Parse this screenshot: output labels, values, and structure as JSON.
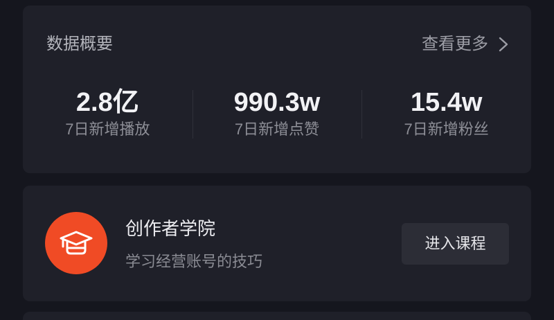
{
  "overview": {
    "title": "数据概要",
    "more_label": "查看更多",
    "more_icon": "chevron-right-icon",
    "stats": [
      {
        "value": "2.8亿",
        "label": "7日新增播放"
      },
      {
        "value": "990.3w",
        "label": "7日新增点赞"
      },
      {
        "value": "15.4w",
        "label": "7日新增粉丝"
      }
    ]
  },
  "academy": {
    "icon": "graduation-cap-icon",
    "title": "创作者学院",
    "subtitle": "学习经营账号的技巧",
    "button_label": "进入课程"
  },
  "colors": {
    "page_background": "#15161e",
    "card_background": "#1f2029",
    "academy_icon_background": "#f04b25",
    "button_background": "#2c2d36"
  }
}
